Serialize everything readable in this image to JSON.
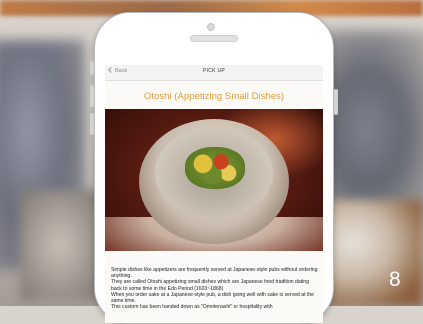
{
  "app": {
    "back_label": "Back",
    "topbar_title": "PICK UP"
  },
  "article": {
    "title": "Otoshi (Appetizing Small Dishes)",
    "photo_description_icon": "food-bowl-photo",
    "paragraphs": [
      "Simple dishes like appetizers are frequently served at Japanese-style pubs without ordering anything.",
      "They are called Otoshi appetizing small dishes which are Japanese food tradition dating back to some time in the Edo Period (1603~1868)",
      "When you order sake at a Japanese-style pub, a dish going well with sake is served at the same time.",
      "This custom has been handed down as \"Omotenashi\" or hospitality with"
    ]
  },
  "page_number": "8",
  "colors": {
    "title_accent": "#e49b3d"
  }
}
